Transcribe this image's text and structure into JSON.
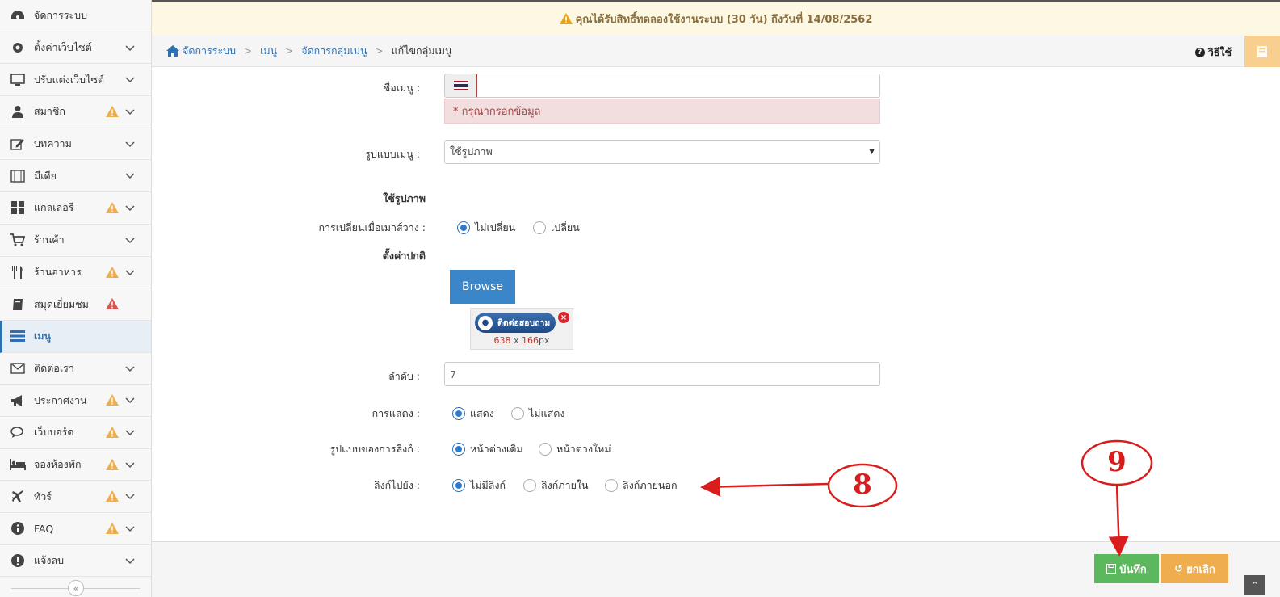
{
  "sidebar": {
    "items": [
      {
        "label": "จัดการระบบ",
        "icon": "dashboard-icon",
        "warn": "",
        "chevron": false
      },
      {
        "label": "ตั้งค่าเว็บไซต์",
        "icon": "gear-icon",
        "warn": "",
        "chevron": true
      },
      {
        "label": "ปรับแต่งเว็บไซต์",
        "icon": "monitor-icon",
        "warn": "",
        "chevron": true
      },
      {
        "label": "สมาชิก",
        "icon": "user-icon",
        "warn": "yellow",
        "chevron": true
      },
      {
        "label": "บทความ",
        "icon": "edit-icon",
        "warn": "",
        "chevron": true
      },
      {
        "label": "มีเดีย",
        "icon": "film-icon",
        "warn": "",
        "chevron": true
      },
      {
        "label": "แกลเลอรี",
        "icon": "grid-icon",
        "warn": "yellow",
        "chevron": true
      },
      {
        "label": "ร้านค้า",
        "icon": "cart-icon",
        "warn": "",
        "chevron": true
      },
      {
        "label": "ร้านอาหาร",
        "icon": "cutlery-icon",
        "warn": "yellow",
        "chevron": true
      },
      {
        "label": "สมุดเยี่ยมชม",
        "icon": "book-icon",
        "warn": "red",
        "chevron": false
      },
      {
        "label": "เมนู",
        "icon": "menu-icon",
        "warn": "",
        "chevron": false,
        "active": true
      },
      {
        "label": "ติดต่อเรา",
        "icon": "envelope-icon",
        "warn": "",
        "chevron": true
      },
      {
        "label": "ประกาศงาน",
        "icon": "megaphone-icon",
        "warn": "yellow",
        "chevron": true
      },
      {
        "label": "เว็บบอร์ด",
        "icon": "comments-icon",
        "warn": "yellow",
        "chevron": true
      },
      {
        "label": "จองห้องพัก",
        "icon": "bed-icon",
        "warn": "yellow",
        "chevron": true
      },
      {
        "label": "ทัวร์",
        "icon": "plane-icon",
        "warn": "yellow",
        "chevron": true
      },
      {
        "label": "FAQ",
        "icon": "info-icon",
        "warn": "yellow",
        "chevron": true
      },
      {
        "label": "แจ้งลบ",
        "icon": "exclamation-icon",
        "warn": "",
        "chevron": true
      }
    ],
    "collapse_glyph": "«"
  },
  "notice": {
    "text": "คุณได้รับสิทธิ์ทดลองใช้งานระบบ (30 วัน) ถึงวันที่ 14/08/2562"
  },
  "breadcrumb": {
    "items": [
      "จัดการระบบ",
      "เมนู",
      "จัดการกลุ่มเมนู",
      "แก้ไขกลุ่มเมนู"
    ],
    "help_label": "วิธีใช้"
  },
  "form": {
    "menu_name_label": "ชื่อเมนู :",
    "menu_name_value": "",
    "error_text": "* กรุณากรอกข้อมูล",
    "menu_type_label": "รูปแบบเมนู :",
    "menu_type_value": "ใช้รูปภาพ",
    "image_section_title": "ใช้รูปภาพ",
    "hover_label": "การเปลี่ยนเมื่อเมาส์วาง :",
    "hover_options": [
      "ไม่เปลี่ยน",
      "เปลี่ยน"
    ],
    "hover_selected": 0,
    "default_label": "ตั้งค่าปกติ",
    "browse_label": "Browse",
    "thumb_text": "ติดต่อสอบถาม",
    "thumb_width": "638",
    "thumb_x": "x",
    "thumb_height": "166",
    "thumb_unit": "px",
    "order_label": "ลำดับ :",
    "order_value": "7",
    "display_label": "การแสดง :",
    "display_options": [
      "แสดง",
      "ไม่แสดง"
    ],
    "display_selected": 0,
    "link_type_label": "รูปแบบของการลิงก์ :",
    "link_type_options": [
      "หน้าต่างเดิม",
      "หน้าต่างใหม่"
    ],
    "link_type_selected": 0,
    "link_to_label": "ลิงก์ไปยัง :",
    "link_to_options": [
      "ไม่มีลิงก์",
      "ลิงก์ภายใน",
      "ลิงก์ภายนอก"
    ],
    "link_to_selected": 0
  },
  "footer": {
    "save_label": "บันทึก",
    "cancel_label": "ยกเลิก",
    "scroll_top_glyph": "⌃"
  },
  "annotations": {
    "step8": "8",
    "step9": "9",
    "color": "#d91c1c"
  },
  "colors": {
    "primary": "#2c6fb5",
    "success": "#5cb85c",
    "warning": "#f0ad4e",
    "danger": "#d9534f",
    "notice_bg": "#fcf8e3"
  }
}
